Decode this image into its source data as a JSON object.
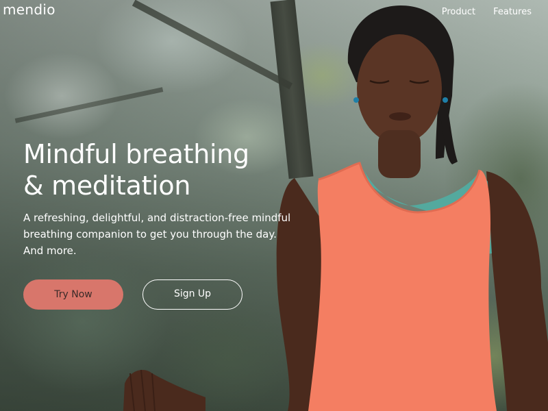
{
  "brand": {
    "logo": "mendio"
  },
  "nav": {
    "items": [
      "Product",
      "Features"
    ]
  },
  "hero": {
    "title_lines": [
      "Mindful breathing",
      "& meditation"
    ],
    "subtitle_lines": [
      "A refreshing, delightful, and distraction-free mindful",
      "breathing companion to get you through the day.",
      "And more."
    ],
    "primary_cta": "Try Now",
    "secondary_cta": "Sign Up"
  },
  "colors": {
    "accent": "#d8766b",
    "text": "#ffffff"
  }
}
